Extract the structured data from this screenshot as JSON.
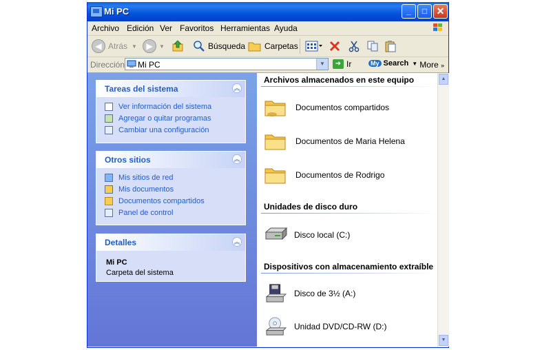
{
  "window": {
    "title": "Mi PC"
  },
  "menu": [
    "Archivo",
    "Edición",
    "Ver",
    "Favoritos",
    "Herramientas",
    "Ayuda"
  ],
  "toolbar": {
    "back_label": "Atrás",
    "search_label": "Búsqueda",
    "folders_label": "Carpetas"
  },
  "address": {
    "label": "Dirección",
    "value": "Mi PC",
    "go_label": "Ir",
    "mysearch_logo": "My",
    "mysearch_label": "Search",
    "more_label": "More"
  },
  "tasks_panel": {
    "title": "Tareas del sistema",
    "items": [
      {
        "label": "Ver información del sistema",
        "icon": "system-info-icon"
      },
      {
        "label": "Agregar o quitar programas",
        "icon": "add-remove-programs-icon"
      },
      {
        "label": "Cambiar una configuración",
        "icon": "change-settings-icon"
      }
    ]
  },
  "places_panel": {
    "title": "Otros sitios",
    "items": [
      {
        "label": "Mis sitios de red",
        "icon": "network-places-icon"
      },
      {
        "label": "Mis documentos",
        "icon": "my-documents-icon"
      },
      {
        "label": "Documentos compartidos",
        "icon": "shared-documents-icon"
      },
      {
        "label": "Panel de control",
        "icon": "control-panel-icon"
      }
    ]
  },
  "details_panel": {
    "title": "Detalles",
    "name": "Mi PC",
    "description": "Carpeta del sistema"
  },
  "sections": [
    {
      "title": "Archivos almacenados en este equipo",
      "items": [
        {
          "label": "Documentos compartidos",
          "icon": "folder-icon"
        },
        {
          "label": "Documentos de Maria Helena",
          "icon": "folder-icon"
        },
        {
          "label": "Documentos de Rodrigo",
          "icon": "folder-icon"
        }
      ]
    },
    {
      "title": "Unidades de disco duro",
      "items": [
        {
          "label": "Disco local (C:)",
          "icon": "hard-drive-icon"
        }
      ]
    },
    {
      "title": "Dispositivos con almacenamiento extraíble",
      "items": [
        {
          "label": "Disco de 3½ (A:)",
          "icon": "floppy-drive-icon"
        },
        {
          "label": "Unidad DVD/CD-RW (D:)",
          "icon": "dvd-drive-icon"
        }
      ]
    }
  ]
}
